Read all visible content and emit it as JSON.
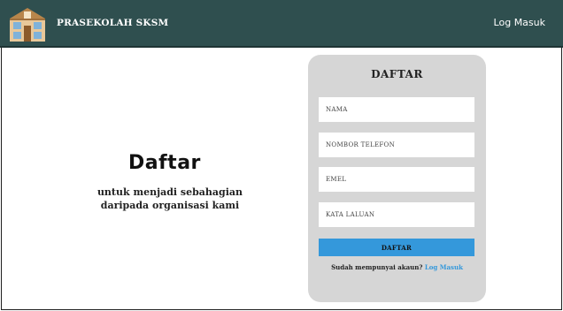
{
  "header": {
    "brand": "PRASEKOLAH SKSM",
    "login_link": "Log Masuk",
    "logo_icon": "school-building-icon"
  },
  "left": {
    "headline": "Daftar",
    "subtitle": "untuk menjadi sebahagian daripada organisasi kami"
  },
  "form": {
    "title": "DAFTAR",
    "fields": [
      {
        "placeholder": "NAMA"
      },
      {
        "placeholder": "NOMBOR TELEFON"
      },
      {
        "placeholder": "EMEL"
      },
      {
        "placeholder": "KATA LALUAN"
      }
    ],
    "submit_label": "DAFTAR",
    "already_text": "Sudah mempunyai akaun?",
    "login_link": "Log Masuk"
  },
  "colors": {
    "navbar": "#2f4f4f",
    "accent": "#3498db",
    "card": "#d6d6d6"
  }
}
